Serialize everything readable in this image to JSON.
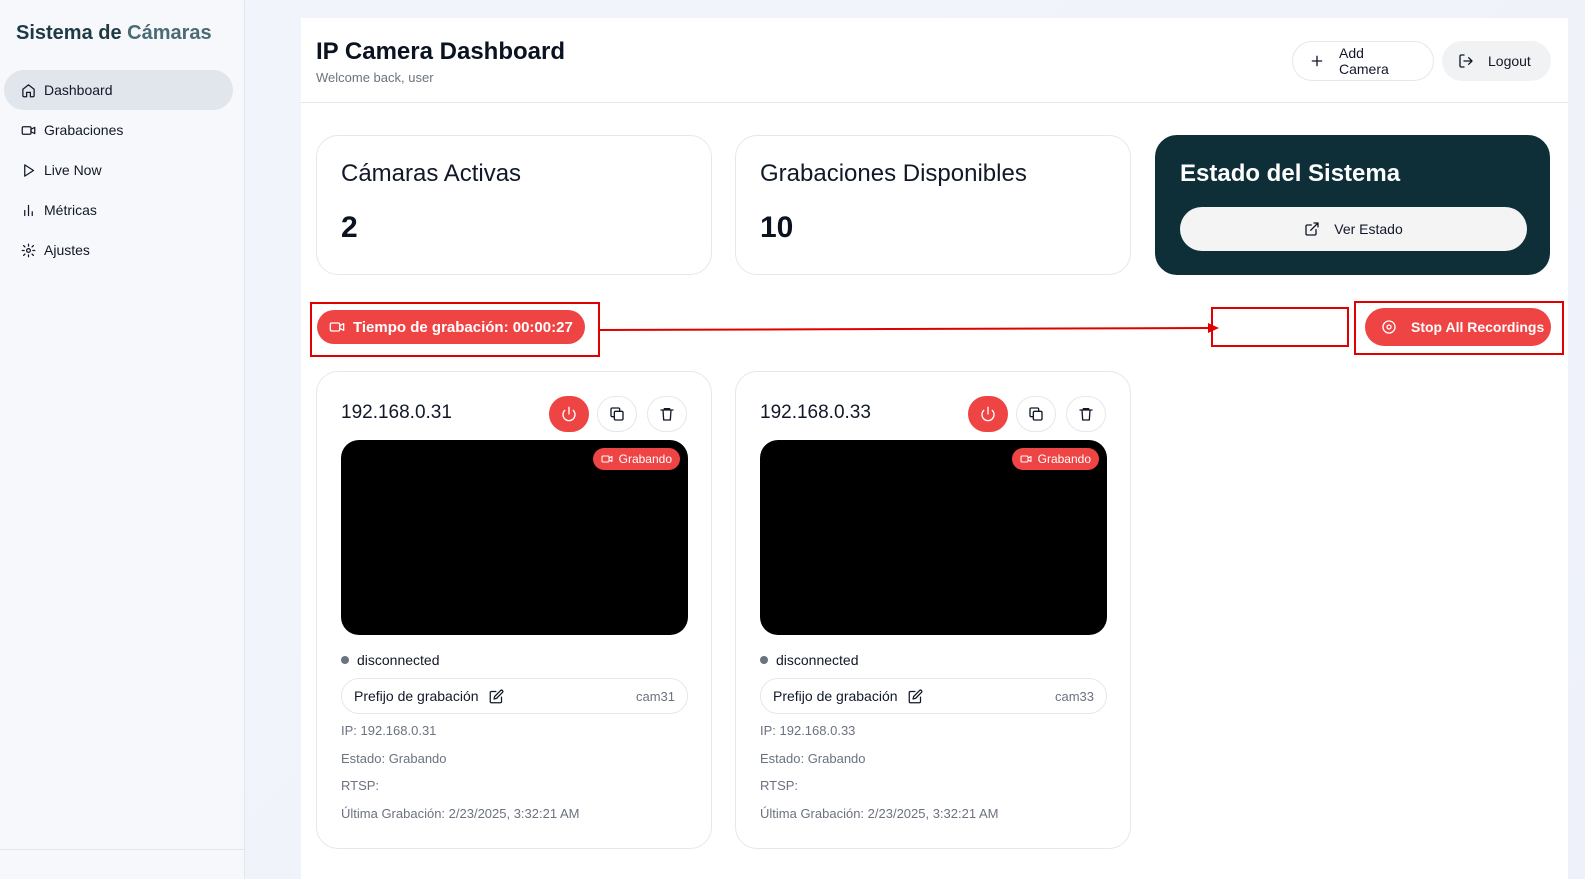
{
  "sidebar": {
    "brand_part1": "Sistema de",
    "brand_part2": "Cámaras",
    "items": [
      {
        "label": "Dashboard",
        "icon": "home-icon",
        "active": true
      },
      {
        "label": "Grabaciones",
        "icon": "video-icon"
      },
      {
        "label": "Live Now",
        "icon": "play-icon"
      },
      {
        "label": "Métricas",
        "icon": "bar-chart-icon"
      },
      {
        "label": "Ajustes",
        "icon": "gear-icon"
      }
    ]
  },
  "header": {
    "title": "IP Camera Dashboard",
    "welcome": "Welcome back, user",
    "add_camera": "Add Camera",
    "logout": "Logout"
  },
  "stats": {
    "active_title": "Cámaras Activas",
    "active_value": "2",
    "recordings_title": "Grabaciones Disponibles",
    "recordings_value": "10",
    "system_title": "Estado del Sistema",
    "system_button": "Ver Estado"
  },
  "recording": {
    "timer": "Tiempo de grabación: 00:00:27",
    "stop_all": "Stop All Recordings"
  },
  "cameras": [
    {
      "ip": "192.168.0.31",
      "badge": "Grabando",
      "connection": "disconnected",
      "prefix_label": "Prefijo de grabación",
      "prefix_value": "cam31",
      "ip_line": "IP: 192.168.0.31",
      "status_line": "Estado: Grabando",
      "rtsp_line": "RTSP:",
      "last_line": "Última Grabación: 2/23/2025, 3:32:21 AM"
    },
    {
      "ip": "192.168.0.33",
      "badge": "Grabando",
      "connection": "disconnected",
      "prefix_label": "Prefijo de grabación",
      "prefix_value": "cam33",
      "ip_line": "IP: 192.168.0.33",
      "status_line": "Estado: Grabando",
      "rtsp_line": "RTSP:",
      "last_line": "Última Grabación: 2/23/2025, 3:32:21 AM"
    }
  ],
  "colors": {
    "accent_red": "#ef4444",
    "dark_teal": "#0e2f38",
    "annotation_red": "#e00000"
  }
}
